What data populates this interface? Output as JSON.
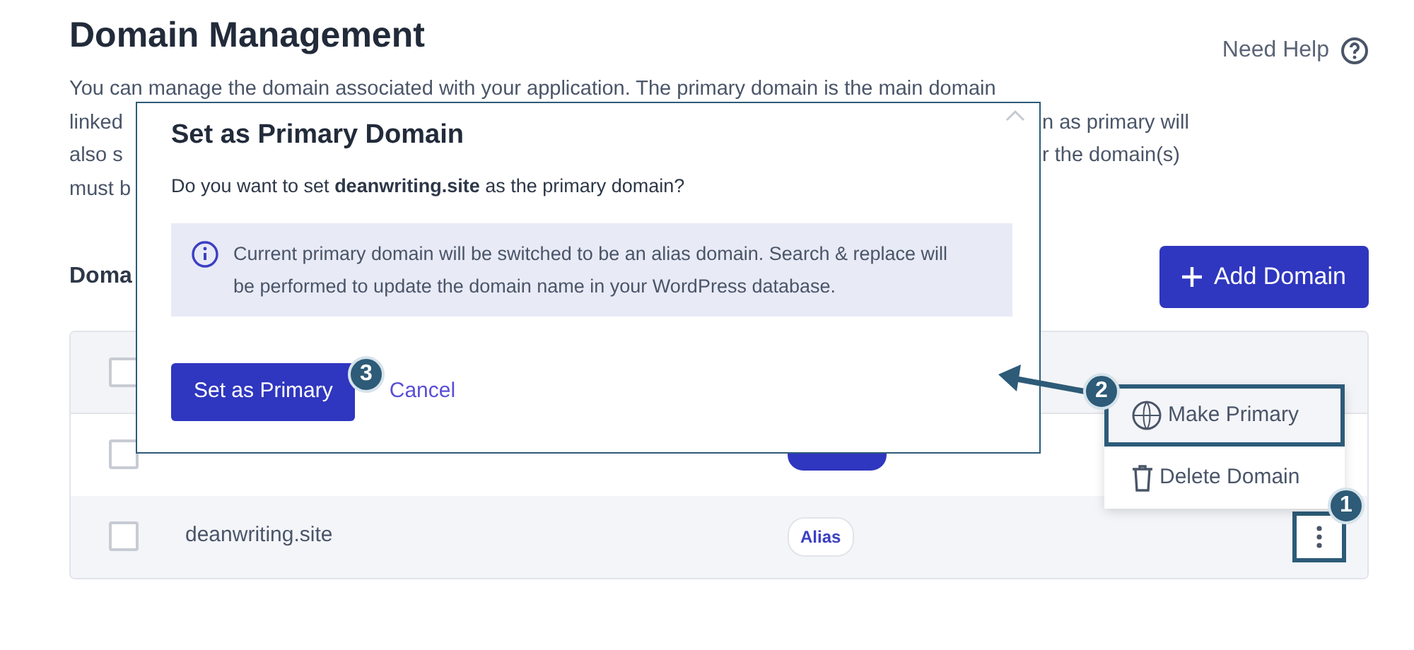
{
  "page": {
    "title": "Domain Management",
    "help_link": "Need Help"
  },
  "description": [
    {
      "left": "You can manage the domain associated with your application. The primary domain is the main domain"
    },
    {
      "left": "linked",
      "right": "n as primary will"
    },
    {
      "left": "also s",
      "right": "r the domain(s)"
    },
    {
      "left": "must b"
    }
  ],
  "section_label": "Doma",
  "add_button": "Add Domain",
  "table": {
    "header_checked": false,
    "rows": [
      {
        "kind": "primary",
        "checked": false
      },
      {
        "domain": "deanwriting.site",
        "kind": "alias",
        "badge": "Alias",
        "checked": false,
        "menu_callout": "1"
      }
    ]
  },
  "row_menu": [
    {
      "label": "Make Primary",
      "kind": "www",
      "callout": "2"
    },
    {
      "label": "Delete Domain",
      "kind": "trash"
    }
  ],
  "modal": {
    "title": "Set as Primary Domain",
    "question": "Do you want to set **deanwriting.site** as the primary domain?",
    "info": "Current primary domain will be switched to be an alias domain. Search & replace will be performed to update the domain name in your WordPress database.",
    "primary_button": "Set as Primary",
    "primary_callout": "3",
    "cancel": "Cancel"
  }
}
